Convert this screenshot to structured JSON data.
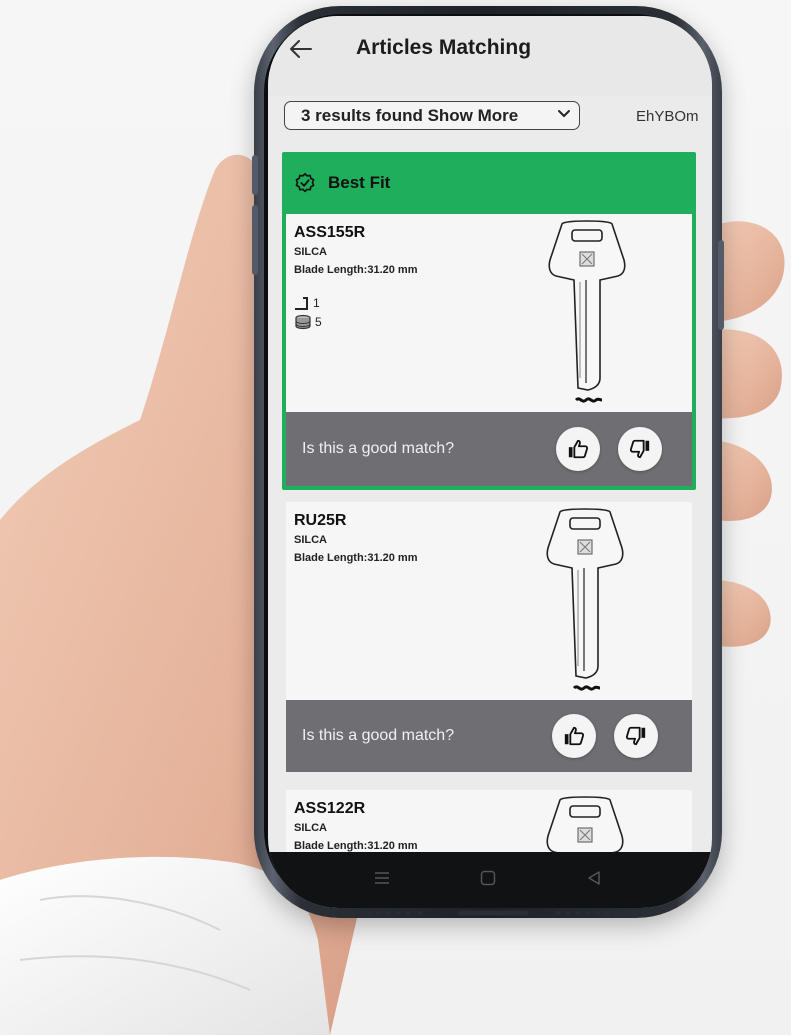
{
  "appbar": {
    "title": "Articles Matching",
    "back_icon": "arrow-left-icon"
  },
  "results": {
    "select_label": "3 results found Show More",
    "session_code": "EhYBOm"
  },
  "best_fit": {
    "label": "Best Fit",
    "icon": "verified-badge-icon",
    "accent": "#1fae5c"
  },
  "cards": [
    {
      "name": "ASS155R",
      "brand": "SILCA",
      "blade": "Blade Length:31.20 mm",
      "stats": [
        {
          "icon": "profile-step-icon",
          "value": "1"
        },
        {
          "icon": "coin-stack-icon",
          "value": "5"
        }
      ]
    },
    {
      "name": "RU25R",
      "brand": "SILCA",
      "blade": "Blade Length:31.20 mm"
    },
    {
      "name": "ASS122R",
      "brand": "SILCA",
      "blade": "Blade Length:31.20 mm"
    }
  ],
  "feedback": {
    "question": "Is this a good match?",
    "like_icon": "thumbs-up-icon",
    "dislike_icon": "thumbs-down-icon"
  },
  "navbar": {
    "items": [
      "menu-icon",
      "home-icon",
      "back-triangle-icon"
    ]
  }
}
